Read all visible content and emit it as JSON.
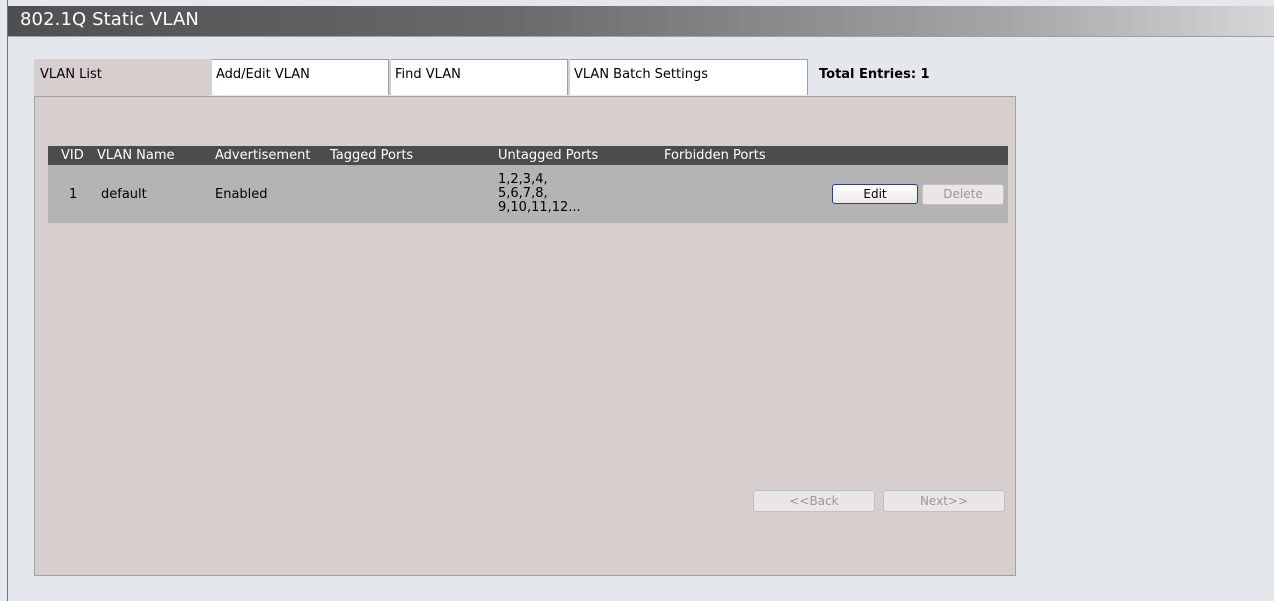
{
  "window": {
    "title": "802.1Q Static VLAN"
  },
  "tabs": [
    {
      "label": "VLAN List",
      "active": true
    },
    {
      "label": "Add/Edit VLAN",
      "active": false
    },
    {
      "label": "Find VLAN",
      "active": false
    },
    {
      "label": "VLAN Batch Settings",
      "active": false
    }
  ],
  "summary": {
    "total_entries": "Total Entries: 1"
  },
  "table": {
    "columns": [
      "VID",
      "VLAN Name",
      "Advertisement",
      "Tagged Ports",
      "Untagged Ports",
      "Forbidden Ports"
    ],
    "rows": [
      {
        "vid": "1",
        "vlan_name": "default",
        "advertisement": "Enabled",
        "tagged_ports": "",
        "untagged_ports": [
          "1,2,3,4,",
          "5,6,7,8,",
          "9,10,11,12..."
        ],
        "forbidden_ports": "",
        "edit_label": "Edit",
        "delete_label": "Delete"
      }
    ]
  },
  "pagination": {
    "back_label": "<<Back",
    "next_label": "Next>>"
  },
  "colors": {
    "panel_bg": "#d7cfcd",
    "table_header_bg": "#4c4c4c",
    "row_bg": "#b4b4b4",
    "page_bg": "#e4e8ec"
  }
}
